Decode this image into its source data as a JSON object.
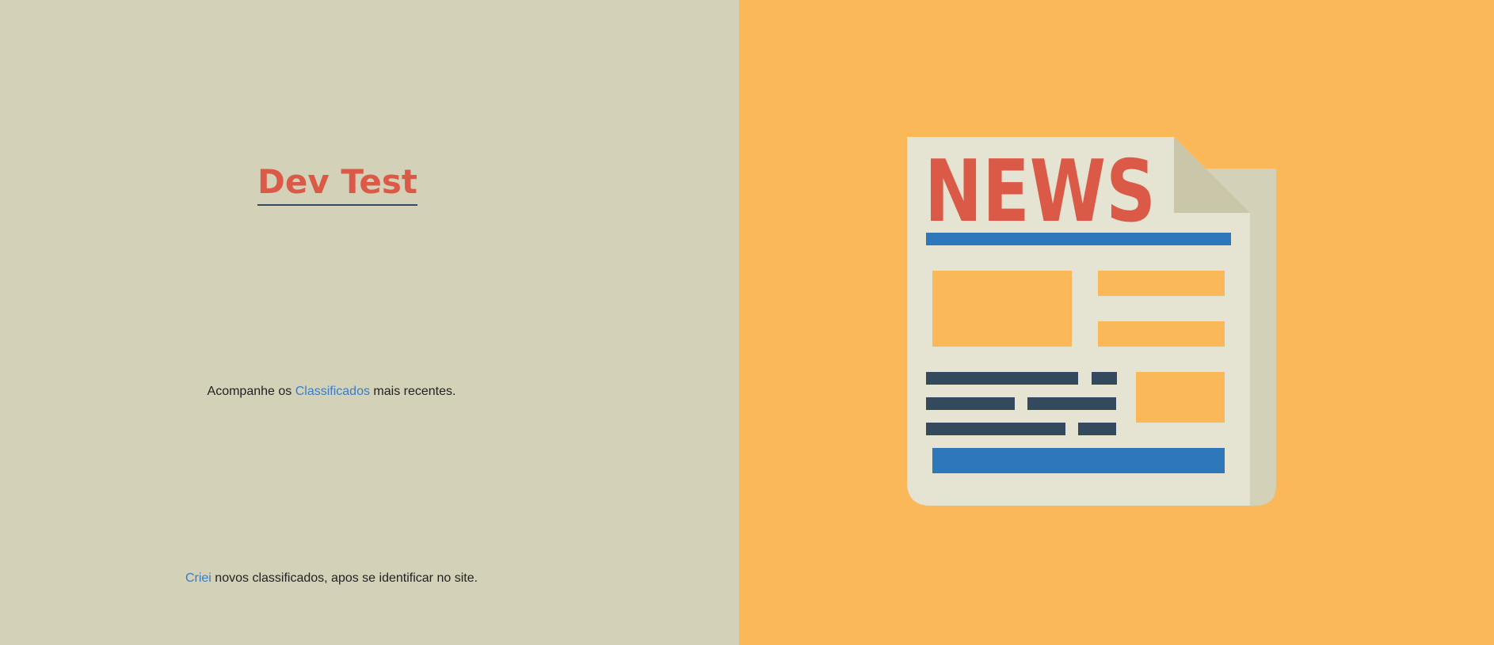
{
  "brand": {
    "title": "Dev Test"
  },
  "intro": {
    "prefix": "Acompanhe os ",
    "link": "Classificados",
    "suffix": " mais recentes."
  },
  "create": {
    "link": "Criei",
    "suffix": " novos classificados, apos se identificar no site."
  },
  "illustration": {
    "icon": "newspaper-icon",
    "headline": "NEWS"
  },
  "colors": {
    "left_bg": "#d3d1b7",
    "right_bg": "#fab858",
    "accent_red": "#db5a47",
    "link_blue": "#3b7cc4",
    "paper": "#e5e3d1",
    "paper_shadow": "#c9c6aa",
    "bar_blue": "#2e77bb",
    "text_dark": "#34495e"
  }
}
